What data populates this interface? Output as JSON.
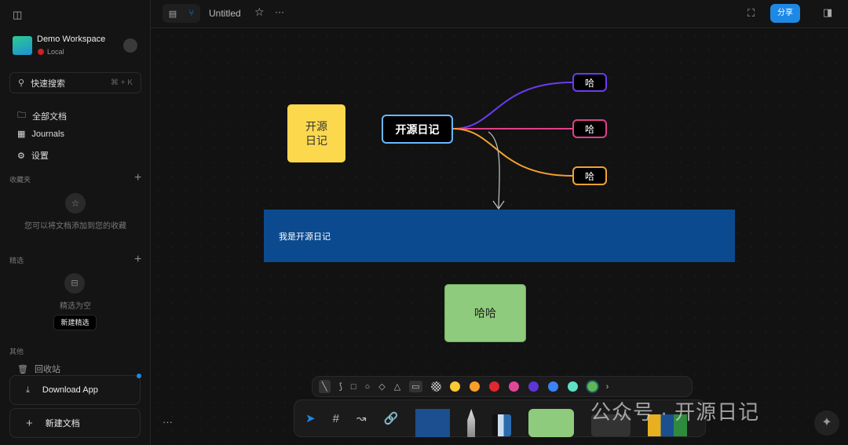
{
  "sidebar": {
    "workspace_name": "Demo Workspace",
    "workspace_status": "Local",
    "search_placeholder": "快速搜索",
    "search_shortcut": "⌘ + K",
    "nav": [
      {
        "label": "全部文档",
        "icon": "folder-icon"
      },
      {
        "label": "Journals",
        "icon": "calendar-icon"
      },
      {
        "label": "设置",
        "icon": "gear-icon"
      }
    ],
    "favorites_title": "收藏夹",
    "favorites_empty": "您可以将文档添加到您的收藏",
    "featured_title": "精选",
    "featured_empty": "精选为空",
    "featured_new": "新建精选",
    "other_title": "其他",
    "trash": "回收站",
    "download_app": "Download App",
    "new_doc": "新建文档"
  },
  "header": {
    "title": "Untitled",
    "share": "分享"
  },
  "canvas": {
    "note": "开源日记",
    "root": "开源日记",
    "children": [
      {
        "label": "哈",
        "color": "#6a3cf0"
      },
      {
        "label": "哈",
        "color": "#e0408a"
      },
      {
        "label": "哈",
        "color": "#f5a030"
      }
    ],
    "banner": "我是开源日记",
    "banner_color": "#0b4a8f",
    "green_box": "哈哈",
    "note_color": "#fcd84d",
    "green_color": "#8fcb7d"
  },
  "toolbar": {
    "colors": [
      "#fcc934",
      "#f99e2a",
      "#e0282e",
      "#e04797",
      "#5e35d6",
      "#3b82f6",
      "#5ee0c6",
      "#5eb654"
    ]
  },
  "watermark": "公众号 · 开源日记"
}
